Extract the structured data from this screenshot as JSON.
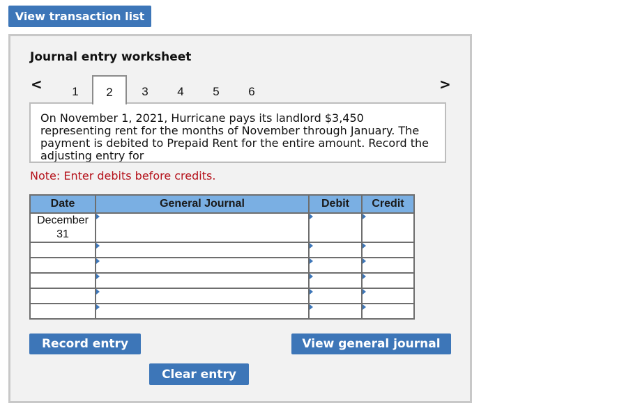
{
  "top_button": {
    "label": "View transaction list"
  },
  "worksheet": {
    "title": "Journal entry worksheet",
    "nav": {
      "prev_icon": "chevron-left-icon",
      "next_icon": "chevron-right-icon",
      "prev_glyph": "<",
      "next_glyph": ">"
    },
    "tabs": [
      {
        "label": "1",
        "active": false
      },
      {
        "label": "2",
        "active": true
      },
      {
        "label": "3",
        "active": false
      },
      {
        "label": "4",
        "active": false
      },
      {
        "label": "5",
        "active": false
      },
      {
        "label": "6",
        "active": false
      }
    ],
    "description": "On November 1, 2021, Hurricane pays its landlord $3,450 representing rent for the months of November through January. The payment is debited to Prepaid Rent for the entire amount. Record the adjusting entry for",
    "note": "Note: Enter debits before credits.",
    "table": {
      "headers": {
        "date": "Date",
        "general_journal": "General Journal",
        "debit": "Debit",
        "credit": "Credit"
      },
      "rows": [
        {
          "date": "December 31",
          "account": "",
          "debit": "",
          "credit": ""
        },
        {
          "date": "",
          "account": "",
          "debit": "",
          "credit": ""
        },
        {
          "date": "",
          "account": "",
          "debit": "",
          "credit": ""
        },
        {
          "date": "",
          "account": "",
          "debit": "",
          "credit": ""
        },
        {
          "date": "",
          "account": "",
          "debit": "",
          "credit": ""
        },
        {
          "date": "",
          "account": "",
          "debit": "",
          "credit": ""
        }
      ]
    },
    "buttons": {
      "record": "Record entry",
      "view_general_journal": "View general journal",
      "clear": "Clear entry"
    }
  },
  "colors": {
    "button_blue": "#3d76b8",
    "header_blue": "#7aafe3",
    "note_red": "#b5121b",
    "panel_bg": "#f2f2f2"
  }
}
